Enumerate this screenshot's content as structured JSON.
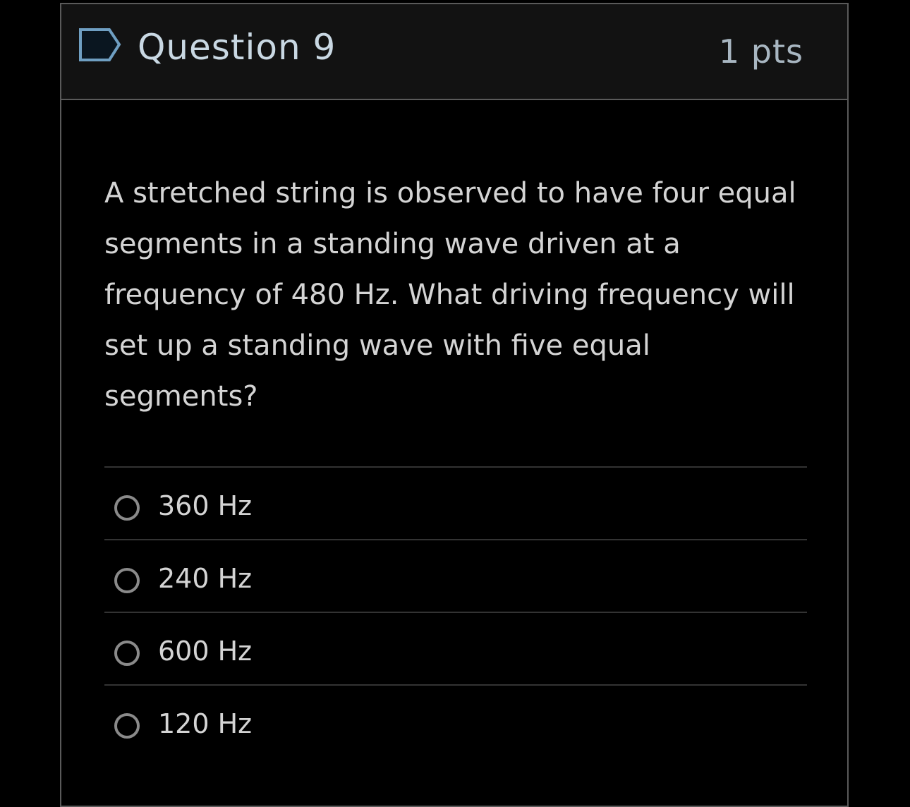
{
  "question": {
    "title": "Question 9",
    "points": "1 pts",
    "flag_icon": "bookmark-flag-icon",
    "text": "A stretched string is observed to have four equal segments in a standing wave driven at a frequency of 480 Hz. What driving frequency will set up a standing wave with five equal segments?"
  },
  "answers": [
    {
      "label": "360 Hz",
      "selected": false
    },
    {
      "label": "240 Hz",
      "selected": false
    },
    {
      "label": "600 Hz",
      "selected": false
    },
    {
      "label": "120 Hz",
      "selected": false
    }
  ],
  "colors": {
    "background": "#000000",
    "header_background": "#121212",
    "border": "#5a5a5a",
    "title_text": "#c9d8e3",
    "body_text": "#d4d4d4",
    "flag_outline": "#5d8fb0"
  }
}
